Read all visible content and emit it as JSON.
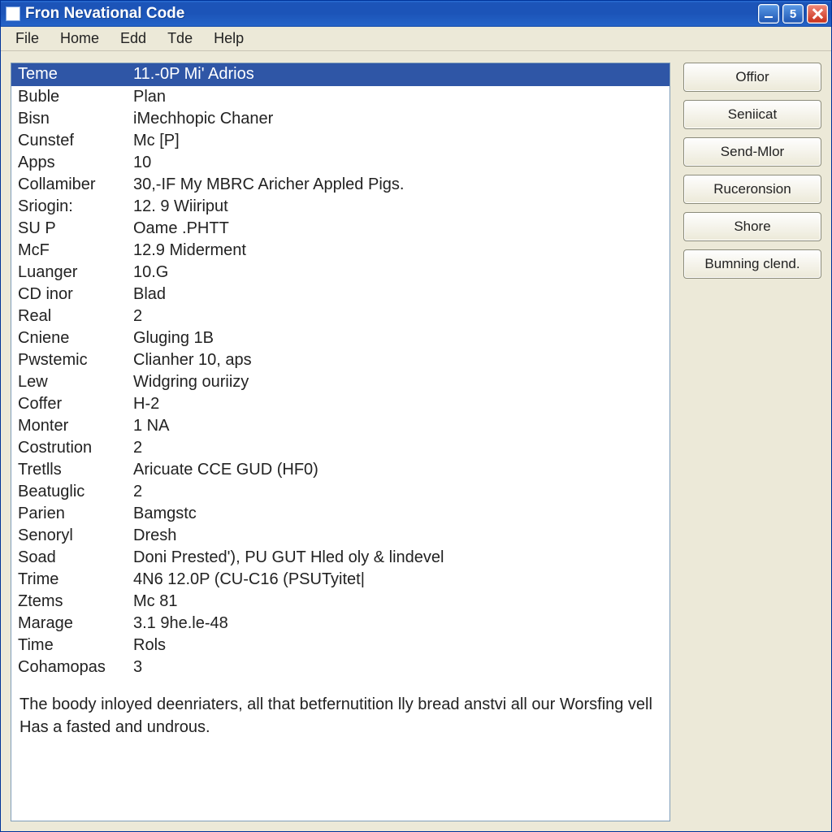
{
  "window": {
    "title": "Fron Nevational Code"
  },
  "caption_buttons": {
    "minimize": "minimize",
    "middle": "5",
    "close": "close"
  },
  "menubar": [
    "File",
    "Home",
    "Edd",
    "Tde",
    "Help"
  ],
  "list_header": {
    "key": "Teme",
    "value": "11.-0P Mi' Adrios"
  },
  "rows": [
    {
      "key": "Buble",
      "value": "Plan"
    },
    {
      "key": "Bisn",
      "value": "iMechhopic Chaner"
    },
    {
      "key": "Cunstef",
      "value": "Mc [P]"
    },
    {
      "key": "Apps",
      "value": "10"
    },
    {
      "key": "Collamiber",
      "value": "30,-IF My MBRC Aricher Appled Pigs."
    },
    {
      "key": "Sriogin:",
      "value": "12. 9 Wiiriput"
    },
    {
      "key": "SU P",
      "value": "Oame .PHTT"
    },
    {
      "key": "McF",
      "value": "12.9 Miderment"
    },
    {
      "key": "Luanger",
      "value": "10.G"
    },
    {
      "key": "CD inor",
      "value": "Blad"
    },
    {
      "key": "Real",
      "value": "2"
    },
    {
      "key": "Cniene",
      "value": "Gluging 1B"
    },
    {
      "key": "Pwstemic",
      "value": "Clianher 10, aps"
    },
    {
      "key": "Lew",
      "value": "Widgring ouriizy"
    },
    {
      "key": "Coffer",
      "value": "H-2"
    },
    {
      "key": "Monter",
      "value": "1 NA"
    },
    {
      "key": "Costrution",
      "value": "2"
    },
    {
      "key": "Tretlls",
      "value": "Aricuate CCE GUD (HF0)"
    },
    {
      "key": "Beatuglic",
      "value": "2"
    },
    {
      "key": "Parien",
      "value": "Bamgstc"
    },
    {
      "key": "Senoryl",
      "value": "Dresh"
    },
    {
      "key": "Soad",
      "value": "Doni Prested'), PU GUT Hled oly & lindevel"
    },
    {
      "key": "Trime",
      "value": "4N6 12.0P (CU-C16 (PSUTyitet|"
    },
    {
      "key": "Ztems",
      "value": "Mc 81"
    },
    {
      "key": "Marage",
      "value": "3.1 9he.le-48"
    },
    {
      "key": "Time",
      "value": "Rols"
    },
    {
      "key": "Cohamopas",
      "value": "3"
    }
  ],
  "description": "The boody inloyed deenriaters, all that betfernutition lly bread anstvi all our Worsfing vell Has a fasted and undrous.",
  "side_buttons": [
    "Offior",
    "Seniicat",
    "Send-Mlor",
    "Ruceronsion",
    "Shore",
    "Bumning clend."
  ]
}
